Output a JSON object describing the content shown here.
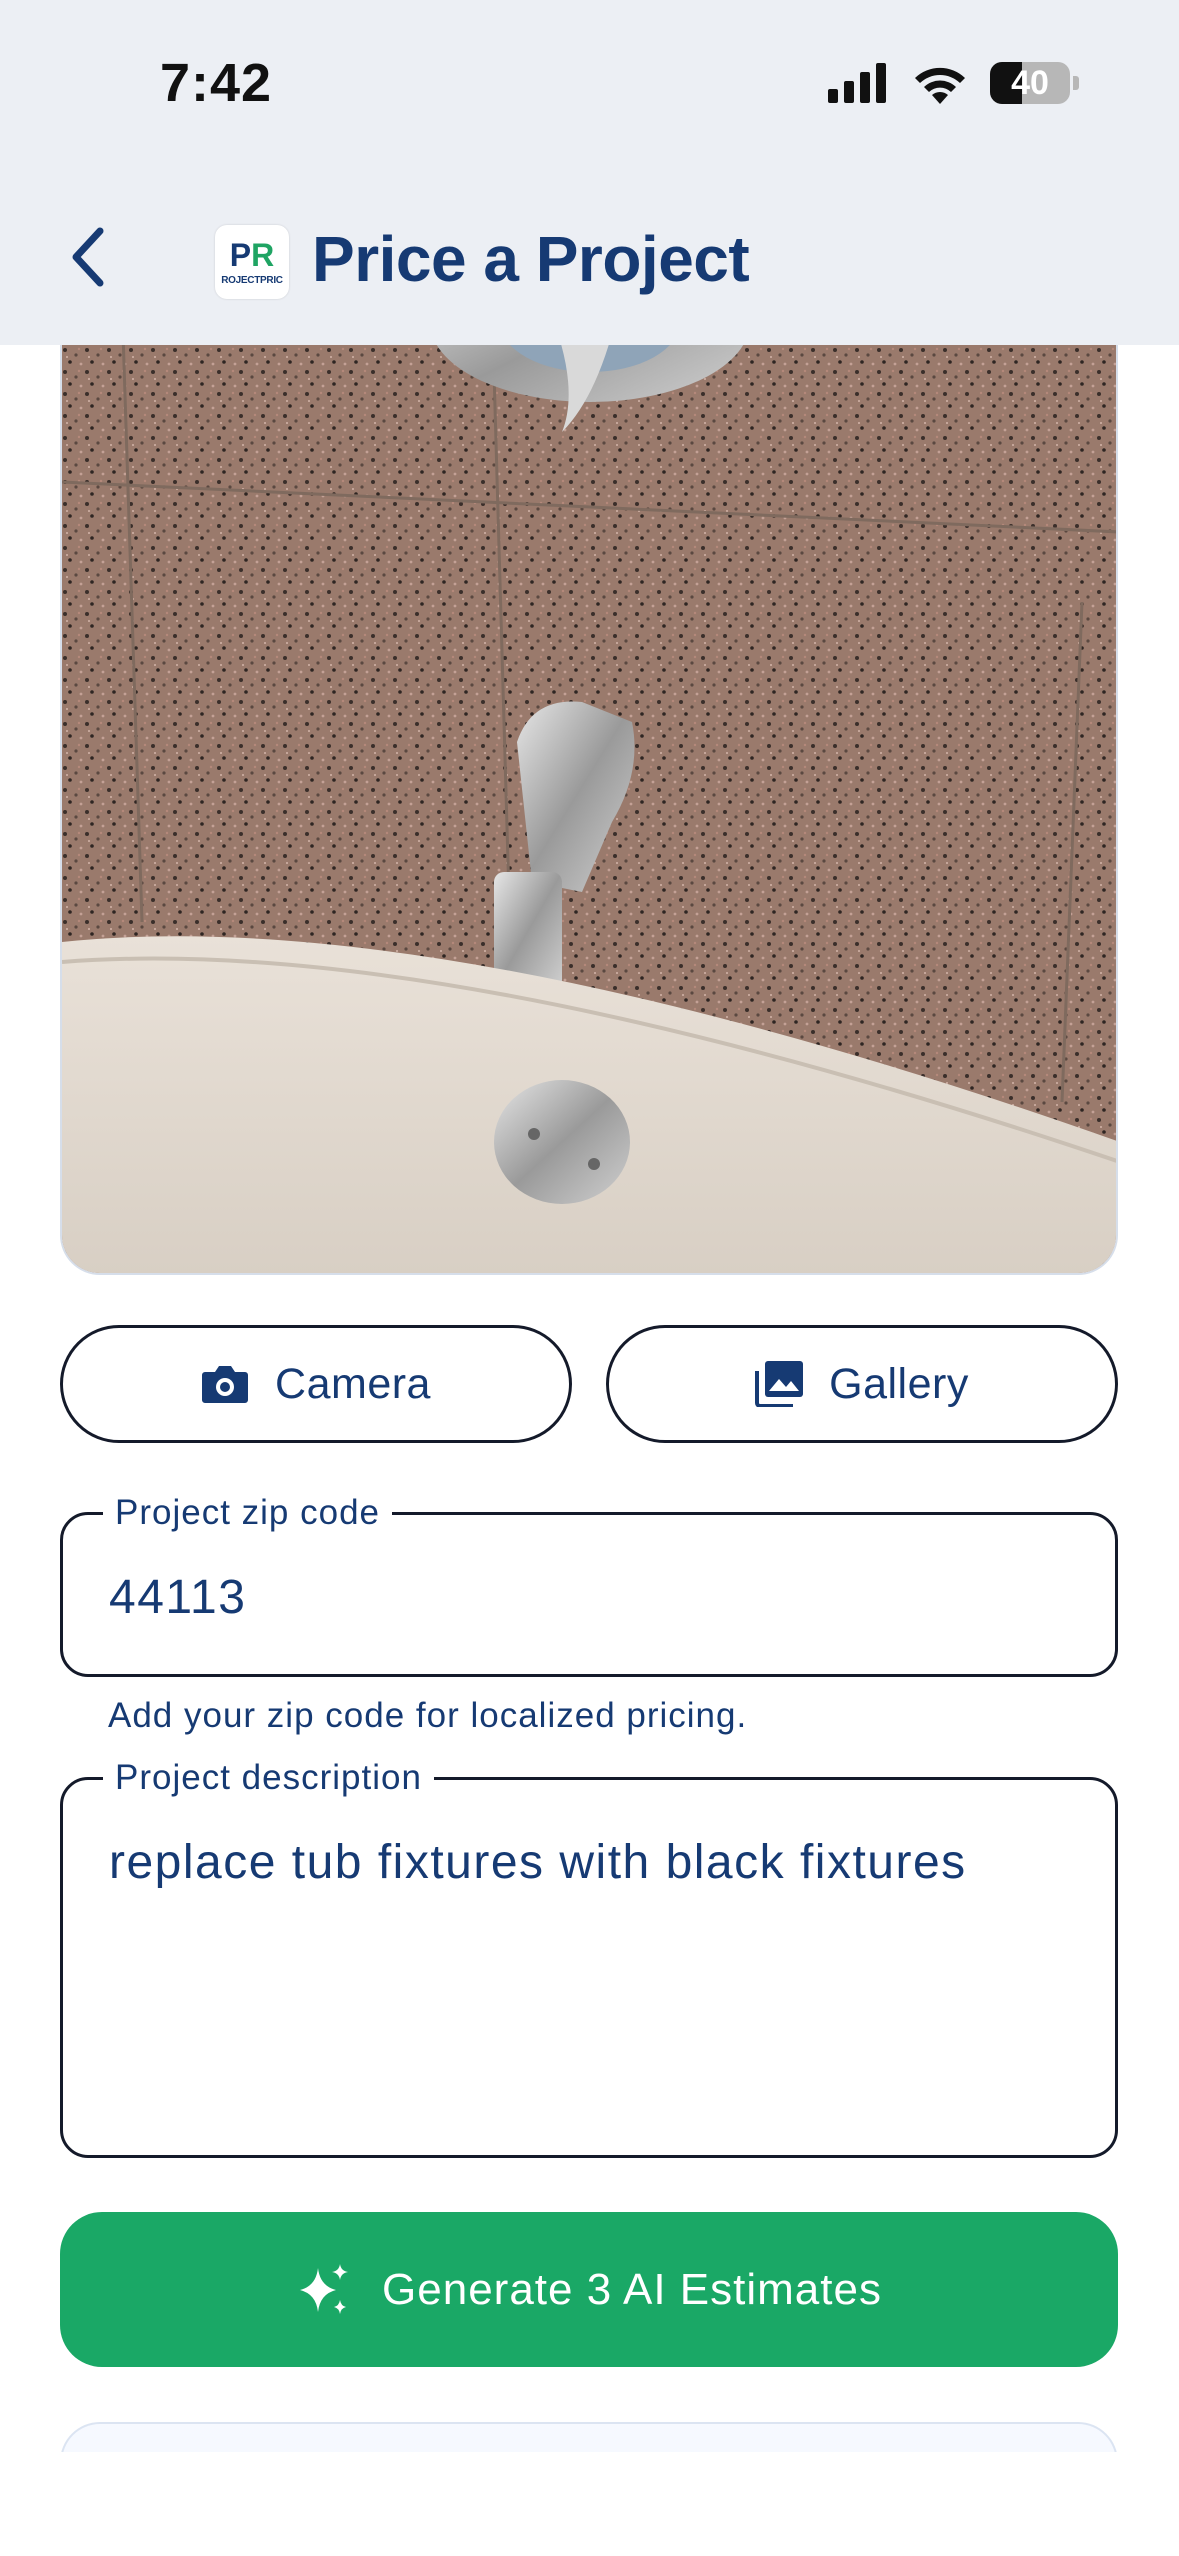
{
  "status_bar": {
    "time": "7:42",
    "battery": "40",
    "battery_level": 0.4
  },
  "header": {
    "title": "Price a Project",
    "back_icon": "chevron-left-icon",
    "logo_text": "ROJECTPRIC",
    "logo_mark_p": "P",
    "logo_mark_r": "R"
  },
  "photo": {
    "description_icon": "bathtub-faucet-photo"
  },
  "buttons": {
    "camera_label": "Camera",
    "gallery_label": "Gallery",
    "camera_icon": "camera-icon",
    "gallery_icon": "image-gallery-icon"
  },
  "zip": {
    "label": "Project zip code",
    "value": "44113",
    "helper": "Add your zip code for localized pricing."
  },
  "description": {
    "label": "Project description",
    "value": "replace tub fixtures with black fixtures"
  },
  "generate": {
    "label": "Generate 3 AI Estimates",
    "icon": "sparkles-icon"
  },
  "colors": {
    "brand_navy": "#163a73",
    "brand_green": "#1aa866",
    "header_bg": "#eceff4"
  }
}
